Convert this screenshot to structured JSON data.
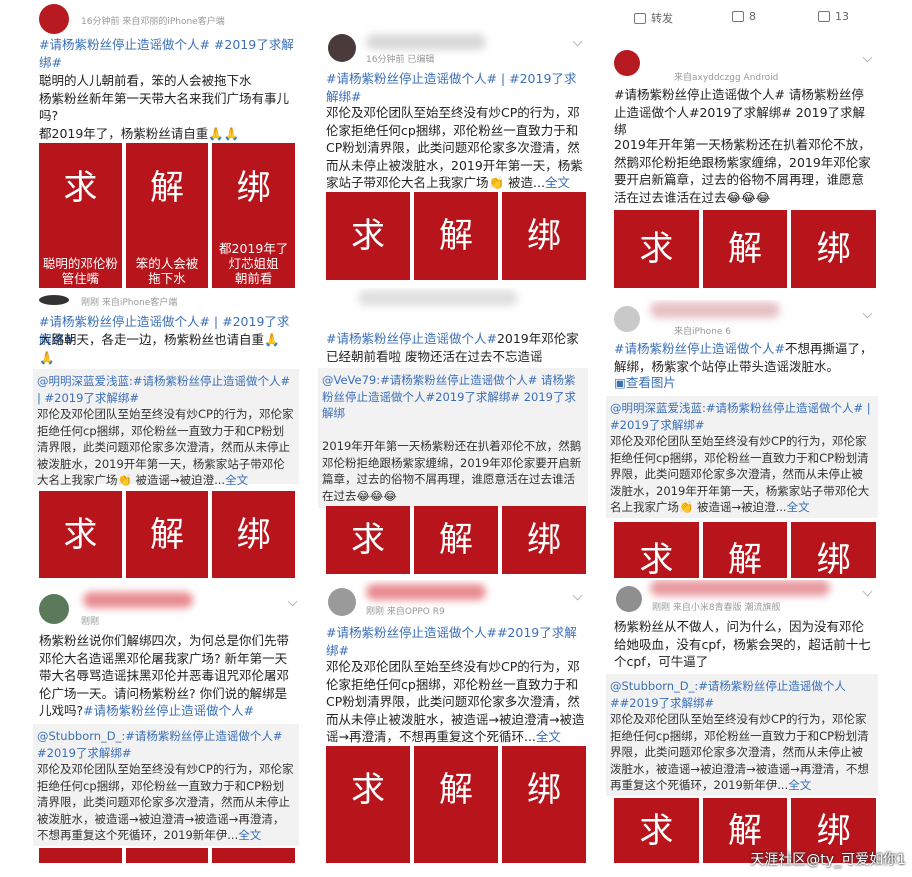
{
  "col1": {
    "post1": {
      "meta": "16分钟前  来自邓丽的iPhone客户端",
      "badge": "求解绑",
      "tags": "#请杨紫粉丝停止造谣做个人# #2019了求解绑#",
      "body": "聪明的人儿朝前看，笨的人会被拖下水\n杨紫粉丝新年第一天带大名来我们广场有事儿吗?\n都2019年了，杨紫粉丝请自重🙏🙏",
      "tiles": [
        {
          "big": "求",
          "cap": "聪明的邓伦粉\n管住嘴"
        },
        {
          "big": "解",
          "cap": "笨的人会被\n拖下水"
        },
        {
          "big": "绑",
          "cap": "都2019年了\n灯芯姐姐\n朝前看"
        }
      ]
    },
    "post2": {
      "meta": "刚刚  来自iPhone客户端",
      "tags": "#请杨紫粉丝停止造谣做个人# | #2019了求解绑#",
      "body": "大路朝天，各走一边，杨紫粉丝也请自重🙏🙏",
      "repost_user": "@明明深蓝爱浅蓝:",
      "repost_tags": "#请杨紫粉丝停止造谣做个人# | #2019了求解绑#",
      "repost_body": "邓伦及邓伦团队至始至终没有炒CP的行为，邓伦家拒绝任何cp捆绑，邓伦粉丝一直致力于和CP粉划清界限，此类问题邓伦家多次澄清，然而从未停止被泼脏水，2019开年第一天，杨紫家站子带邓伦大名上我家广场👏 被造谣→被迫澄...",
      "full": "全文",
      "tiles": [
        {
          "big": "求"
        },
        {
          "big": "解"
        },
        {
          "big": "绑"
        }
      ]
    },
    "post3": {
      "meta": "刚刚",
      "body": "杨紫粉丝说你们解绑四次，为何总是你们先带邓伦大名造谣黑邓伦屠我家广场? 新年第一天带大名辱骂造谣抹黑邓伦并恶毒诅咒邓伦屠邓伦广场一天。请问杨紫粉丝? 你们说的解绑是儿戏吗?",
      "tags": "#请杨紫粉丝停止造谣做个人#",
      "repost_user": "@Stubborn_D_:",
      "repost_tags": "#请杨紫粉丝停止造谣做个人# #2019了求解绑#",
      "repost_body": "邓伦及邓伦团队至始至终没有炒CP的行为，邓伦家拒绝任何cp捆绑，邓伦粉丝一直致力于和CP粉划清界限，此类问题邓伦家多次澄清，然而从未停止被泼脏水，被造谣→被迫澄清→被造谣→再澄清，不想再重复这个死循环，2019新年伊...",
      "full": "全文"
    }
  },
  "col2": {
    "post1": {
      "meta": "16分钟前  已编辑",
      "tags": "#请杨紫粉丝停止造谣做个人# | #2019了求解绑#",
      "body": "邓伦及邓伦团队至始至终没有炒CP的行为，邓伦家拒绝任何cp捆绑，邓伦粉丝一直致力于和CP粉划清界限，此类问题邓伦家多次澄清，然而从未停止被泼脏水，2019开年第一天，杨紫家站子带邓伦大名上我家广场👏 被造...",
      "full": "全文",
      "tiles": [
        {
          "big": "求"
        },
        {
          "big": "解"
        },
        {
          "big": "绑"
        }
      ]
    },
    "post2": {
      "tags": "#请杨紫粉丝停止造谣做个人#",
      "body": "2019年邓伦家已经朝前看啦 废物还活在过去不忘造谣",
      "repost_user": "@VeVe79:",
      "repost_tags": "#请杨紫粉丝停止造谣做个人# 请杨紫粉丝停止造谣做个人#2019了求解绑# 2019了求解绑",
      "repost_body": "2019年开年第一天杨紫粉还在扒着邓伦不放，然鹅邓伦粉拒绝跟杨紫家缠绵，2019年邓伦家要开启新篇章，过去的俗物不屑再理，谁愿意活在过去谁活在过去😂😂😂",
      "tiles": [
        {
          "big": "求"
        },
        {
          "big": "解"
        },
        {
          "big": "绑"
        }
      ]
    },
    "post3": {
      "meta": "刚刚  来自OPPO R9",
      "tags": "#请杨紫粉丝停止造谣做个人##2019了求解绑#",
      "body": "邓伦及邓伦团队至始至终没有炒CP的行为，邓伦家拒绝任何cp捆绑，邓伦粉丝一直致力于和CP粉划清界限，此类问题邓伦家多次澄清，然而从未停止被泼脏水，被造谣→被迫澄清→被造谣→再澄清，不想再重复这个死循环...",
      "full": "全文",
      "tiles": [
        {
          "big": "求"
        },
        {
          "big": "解"
        },
        {
          "big": "绑"
        }
      ]
    }
  },
  "col3": {
    "stats": {
      "repost": "转发",
      "comment": "8",
      "like": "13"
    },
    "post1": {
      "meta": "来自axyddczgg Android",
      "tags": "#请杨紫粉丝停止造谣做个人# 请杨紫粉丝停止造谣做个人#2019了求解绑# 2019了求解绑",
      "body": "2019年开年第一天杨紫粉还在扒着邓伦不放，然鹅邓伦粉拒绝跟杨紫家缠绵，2019年邓伦家要开启新篇章，过去的俗物不屑再理，谁愿意活在过去谁活在过去😂😂😂",
      "tiles": [
        {
          "big": "求"
        },
        {
          "big": "解"
        },
        {
          "big": "绑"
        }
      ]
    },
    "post2": {
      "meta": "来自iPhone 6",
      "tags": "#请杨紫粉丝停止造谣做个人#",
      "body": "不想再撕逼了，解绑，杨紫家个站停止带头造谣泼脏水。",
      "view_pic": "查看图片",
      "repost_user": "@明明深蓝爱浅蓝:",
      "repost_tags": "#请杨紫粉丝停止造谣做个人# | #2019了求解绑#",
      "repost_body": "邓伦及邓伦团队至始至终没有炒CP的行为，邓伦家拒绝任何cp捆绑，邓伦粉丝一直致力于和CP粉划清界限，此类问题邓伦家多次澄清，然而从未停止被泼脏水，2019年开年第一天，杨紫家站子带邓伦大名上我家广场👏 被造谣→被迫澄...",
      "full": "全文",
      "tiles": [
        {
          "big": "求"
        },
        {
          "big": "解"
        },
        {
          "big": "绑"
        }
      ]
    },
    "post3": {
      "meta": "刚刚  来自小米8青春版  潮流旗舰",
      "body": "杨紫粉丝从不做人，问为什么，因为没有邓伦给她吸血，没有cpf，杨紫会哭的，超话前十七个cpf，可牛逼了",
      "repost_user": "@Stubborn_D_:",
      "repost_tags": "#请杨紫粉丝停止造谣做个人##2019了求解绑#",
      "repost_body": "邓伦及邓伦团队至始至终没有炒CP的行为，邓伦家拒绝任何cp捆绑，邓伦粉丝一直致力于和CP粉划清界限，此类问题邓伦家多次澄清，然而从未停止被泼脏水，被造谣→被迫澄清→被造谣→再澄清，不想再重复这个死循环，2019新年伊...",
      "full": "全文",
      "tiles": [
        {
          "big": "求"
        },
        {
          "big": "解"
        },
        {
          "big": "绑"
        }
      ]
    }
  },
  "watermark": "天涯社区@ty_可爱如你1"
}
